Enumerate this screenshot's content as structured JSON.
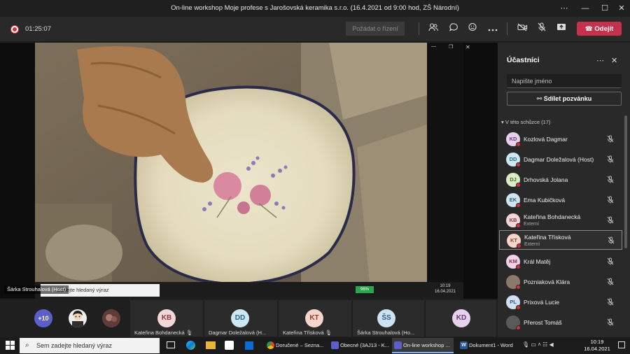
{
  "window": {
    "title": "On-line workshop Moje profese s Jarošovská keramika s.r.o. (16.4.2021 od 9:00 hod, ZŠ Národní)",
    "controls": [
      "⋯",
      "—",
      "☐",
      "✕"
    ]
  },
  "meeting": {
    "timer": "01:25:07",
    "request_control_label": "Požádat o řízení",
    "leave_label": "Odejít",
    "icons": [
      "people-icon",
      "chat-icon",
      "reactions-icon",
      "more-icon",
      "camera-off-icon",
      "mic-off-icon",
      "share-icon"
    ]
  },
  "stage": {
    "presenter_tag": "Šárka Strouhalová (Host)",
    "inner_search_placeholder": "Zadejte hledaný výraz",
    "inner_clock_time": "10:19",
    "inner_clock_date": "16.04.2021",
    "inner_battery": "96%"
  },
  "bottom_participants": {
    "overflow_count": "+10",
    "tiles": [
      {
        "initials": "KB",
        "name": "Kateřina Bohdanecká",
        "color": "#f3d6d8",
        "text": "#8a3a40"
      },
      {
        "initials": "DD",
        "name": "Dagmar Doležalová (H...",
        "color": "#cde7f3",
        "text": "#2b6a86"
      },
      {
        "initials": "KT",
        "name": "Kateřina Třísková",
        "color": "#f6d5cc",
        "text": "#9a3d23"
      },
      {
        "initials": "ŠS",
        "name": "Šárka Strouhalová (Ho...",
        "color": "#cde2f3",
        "text": "#2a5f8a"
      },
      {
        "initials": "KD",
        "name": "",
        "color": "#e6d2ec",
        "text": "#6e3a7e"
      }
    ]
  },
  "panel": {
    "title": "Účastníci",
    "search_placeholder": "Napište jméno",
    "invite_label": "Sdílet pozvánku",
    "section_label": "V této schůzce (17)",
    "participants": [
      {
        "initials": "KD",
        "name": "Kozlová Dagmar",
        "sub": "",
        "color": "#e6d2ec",
        "text": "#6e3a7e"
      },
      {
        "initials": "DD",
        "name": "Dagmar Doležalová (Host)",
        "sub": "",
        "color": "#cde7f3",
        "text": "#2b6a86"
      },
      {
        "initials": "DJ",
        "name": "Drhovská Jolana",
        "sub": "",
        "color": "#dcebc9",
        "text": "#4d6e22"
      },
      {
        "initials": "EK",
        "name": "Ema Kubičková",
        "sub": "",
        "color": "#cfe5ef",
        "text": "#2b6278"
      },
      {
        "initials": "KB",
        "name": "Kateřina Bohdanecká",
        "sub": "Externí",
        "color": "#f3d6d8",
        "text": "#8a3a40"
      },
      {
        "initials": "KT",
        "name": "Kateřina Třísková",
        "sub": "Externí",
        "color": "#f6d5cc",
        "text": "#9a3d23"
      },
      {
        "initials": "KM",
        "name": "Král Matěj",
        "sub": "",
        "color": "#f1d3e3",
        "text": "#8b2c62"
      },
      {
        "initials": "",
        "name": "Pozniaková Klára",
        "sub": "",
        "color": "#8a7a6a",
        "text": "#ffffff"
      },
      {
        "initials": "PL",
        "name": "Prixová Lucie",
        "sub": "",
        "color": "#d2e0f3",
        "text": "#2c5a8f"
      },
      {
        "initials": "",
        "name": "Přerost Tomáš",
        "sub": "",
        "color": "#5a5a5a",
        "text": "#ffffff"
      }
    ]
  },
  "taskbar": {
    "search_placeholder": "Sem zadejte hledaný výraz",
    "apps": [
      {
        "label": "Doručené – Sezna...",
        "active": false
      },
      {
        "label": "Obecné (3AJ13 - K...",
        "active": false
      },
      {
        "label": "On-line workshop ...",
        "active": true
      },
      {
        "label": "Dokument1 - Word",
        "active": false
      }
    ],
    "time": "10:19",
    "date": "16.04.2021"
  }
}
